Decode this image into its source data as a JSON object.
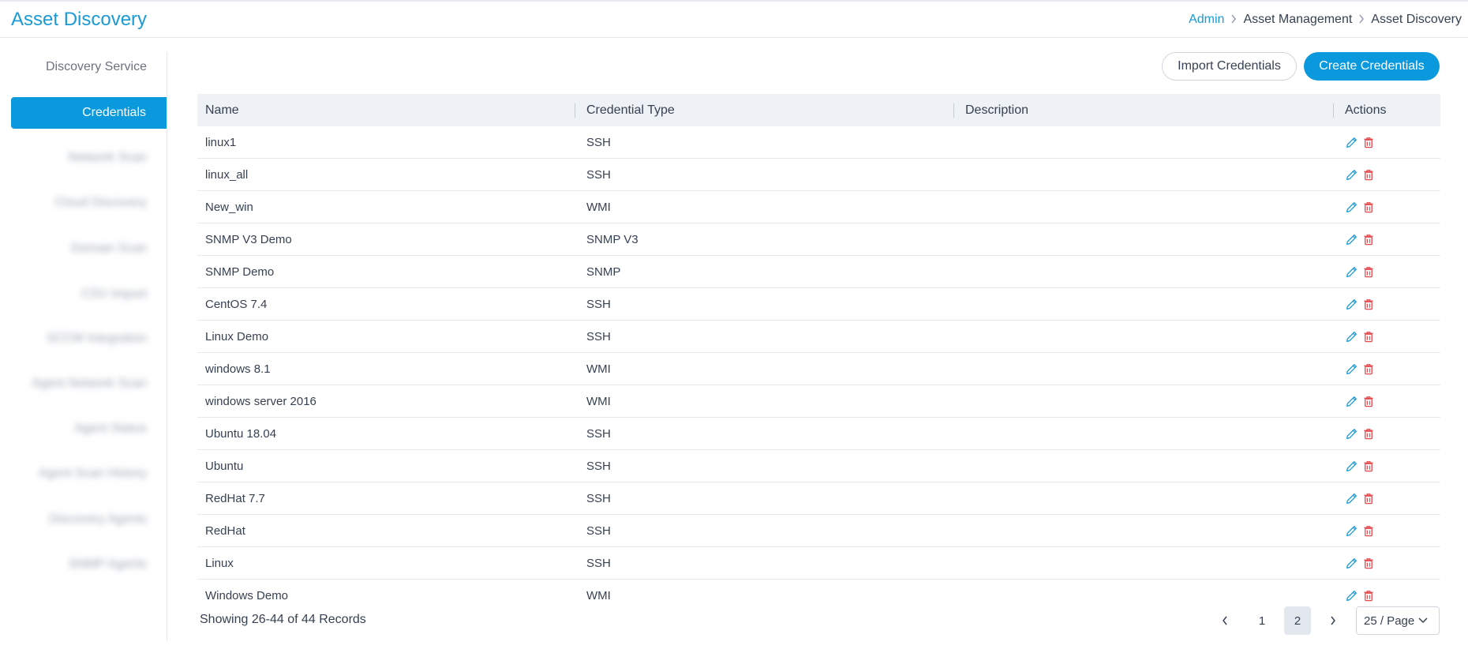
{
  "header": {
    "title": "Asset Discovery",
    "breadcrumb": [
      "Admin",
      "Asset Management",
      "Asset Discovery"
    ]
  },
  "sidebar": {
    "section_label": "Discovery Service",
    "items": [
      {
        "label": "Credentials",
        "active": true
      },
      {
        "label": "Network Scan",
        "blurred": true
      },
      {
        "label": "Cloud Discovery",
        "blurred": true
      },
      {
        "label": "Domain Scan",
        "blurred": true
      },
      {
        "label": "CSV Import",
        "blurred": true
      },
      {
        "label": "SCCM Integration",
        "blurred": true
      },
      {
        "label": "Agent Network Scan",
        "blurred": true
      },
      {
        "label": "Agent Status",
        "blurred": true
      },
      {
        "label": "Agent Scan History",
        "blurred": true
      },
      {
        "label": "Discovery Agents",
        "blurred": true
      },
      {
        "label": "SNMP Agents",
        "blurred": true
      }
    ]
  },
  "toolbar": {
    "import_label": "Import Credentials",
    "create_label": "Create Credentials"
  },
  "table": {
    "columns": [
      "Name",
      "Credential Type",
      "Description",
      "Actions"
    ],
    "rows": [
      {
        "name": "linux1",
        "type": "SSH",
        "description": ""
      },
      {
        "name": "linux_all",
        "type": "SSH",
        "description": ""
      },
      {
        "name": "New_win",
        "type": "WMI",
        "description": ""
      },
      {
        "name": "SNMP V3 Demo",
        "type": "SNMP V3",
        "description": ""
      },
      {
        "name": "SNMP Demo",
        "type": "SNMP",
        "description": ""
      },
      {
        "name": "CentOS 7.4",
        "type": "SSH",
        "description": ""
      },
      {
        "name": "Linux Demo",
        "type": "SSH",
        "description": ""
      },
      {
        "name": "windows 8.1",
        "type": "WMI",
        "description": ""
      },
      {
        "name": "windows server 2016",
        "type": "WMI",
        "description": ""
      },
      {
        "name": "Ubuntu 18.04",
        "type": "SSH",
        "description": ""
      },
      {
        "name": "Ubuntu",
        "type": "SSH",
        "description": ""
      },
      {
        "name": "RedHat 7.7",
        "type": "SSH",
        "description": ""
      },
      {
        "name": "RedHat",
        "type": "SSH",
        "description": ""
      },
      {
        "name": "Linux",
        "type": "SSH",
        "description": ""
      },
      {
        "name": "Windows Demo",
        "type": "WMI",
        "description": ""
      }
    ],
    "action_icons": [
      "pencil-icon",
      "trash-icon"
    ]
  },
  "pagination": {
    "records_text": "Showing 26-44 of 44 Records",
    "pages": [
      "1",
      "2"
    ],
    "current_page": "2",
    "page_size": "25 / Page"
  },
  "colors": {
    "accent": "#0a99dd",
    "title": "#1a9bd7",
    "delete": "#e5484d",
    "edit": "#1a9bd7"
  }
}
